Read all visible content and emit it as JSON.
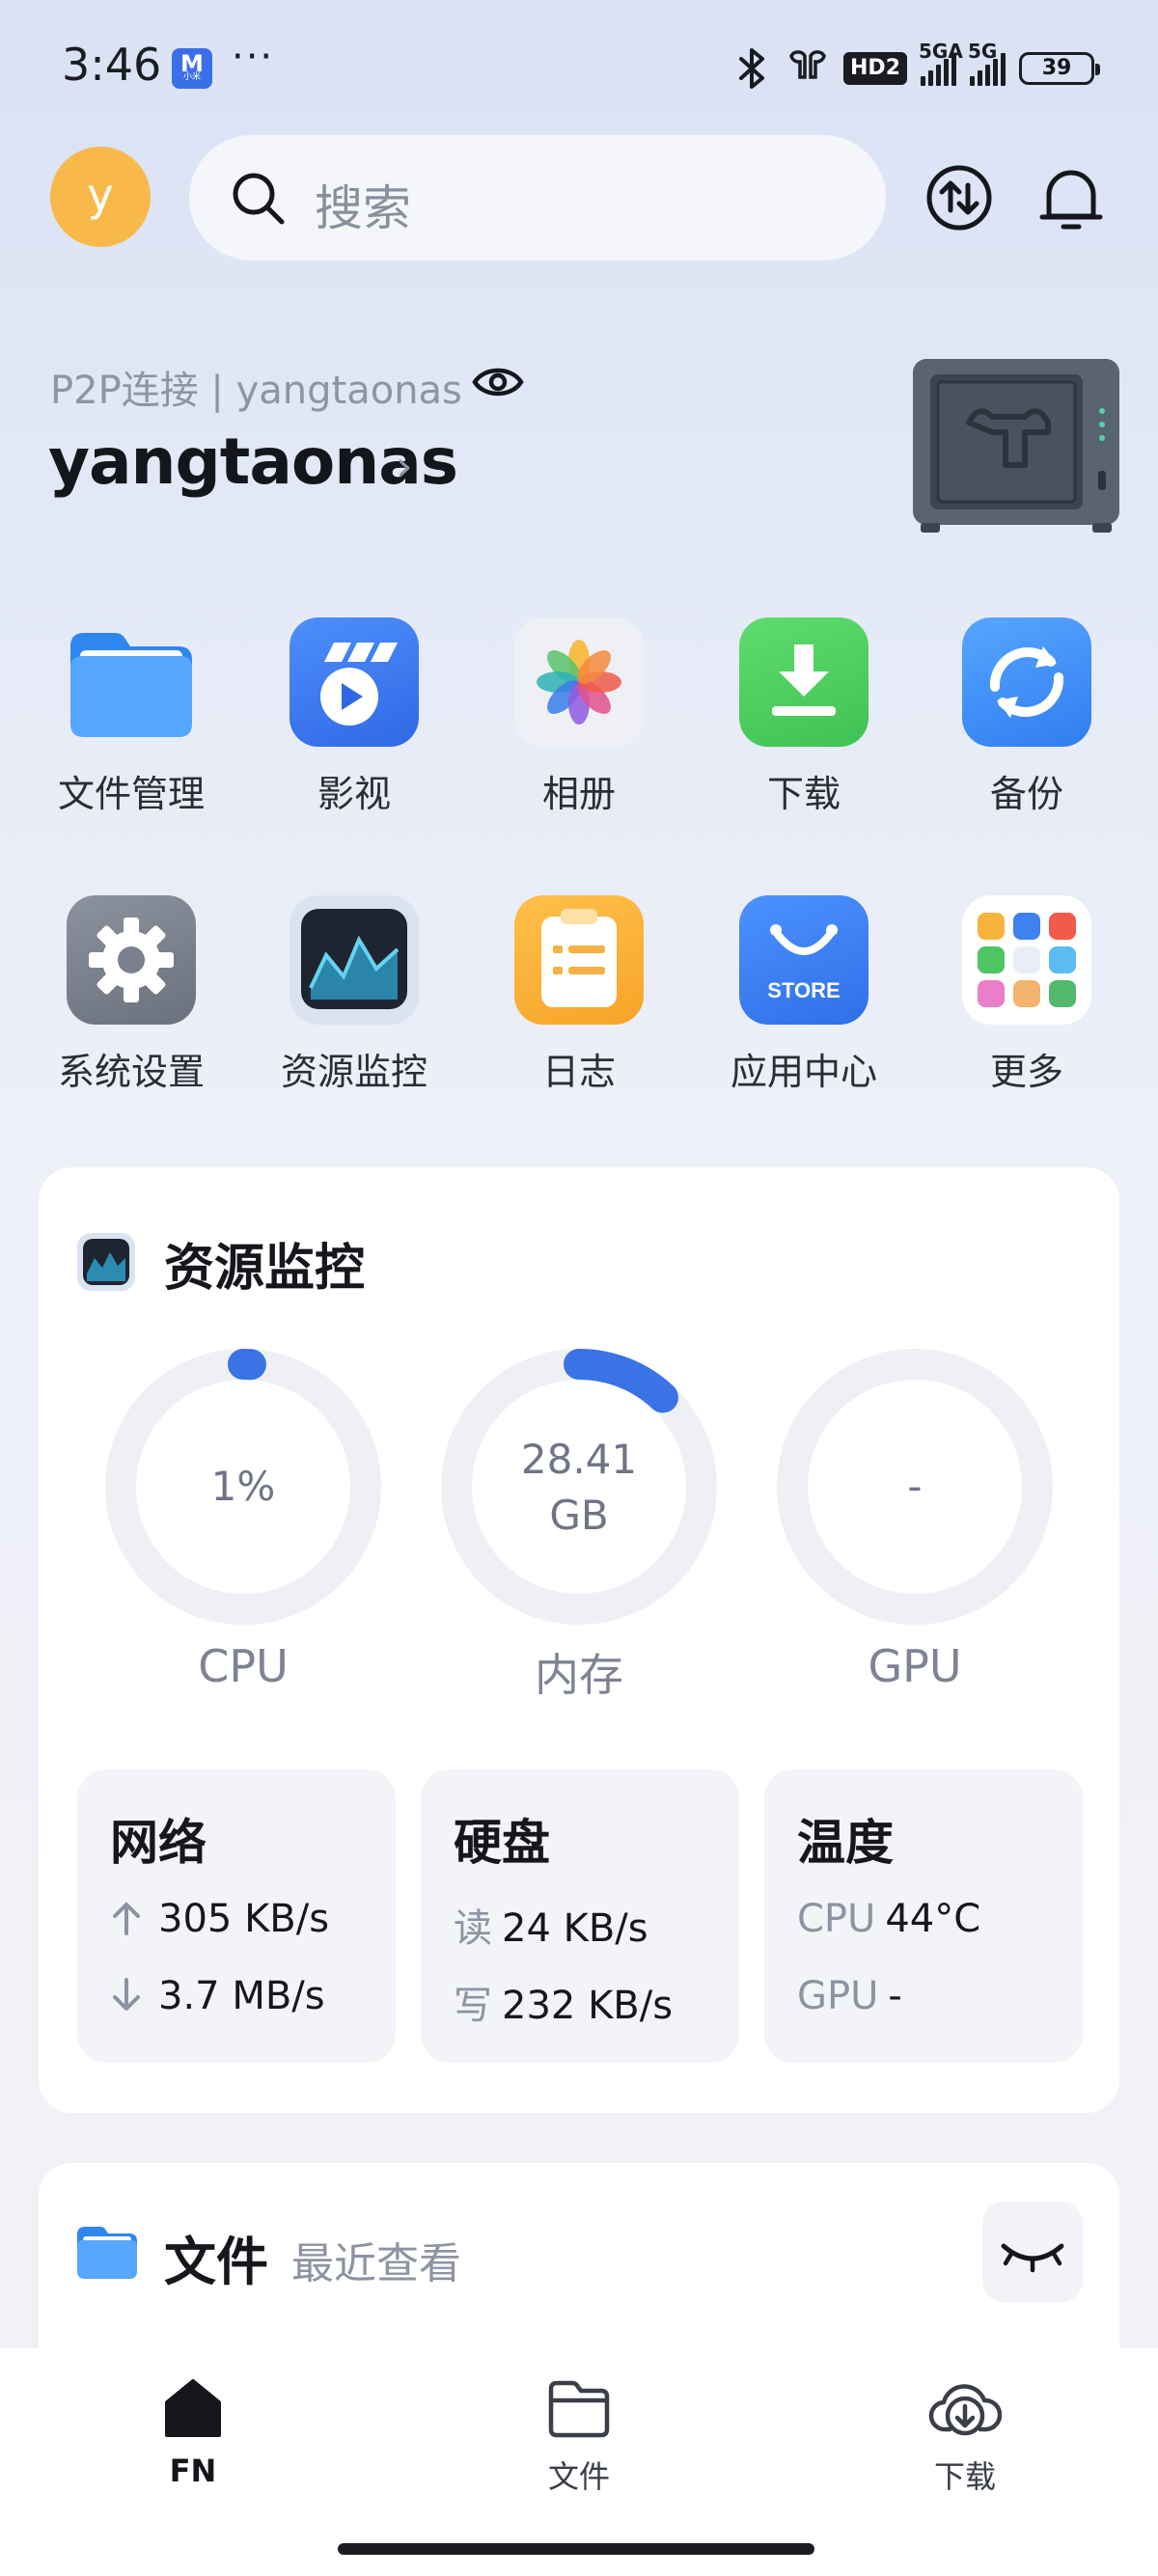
{
  "status_bar": {
    "time": "3:46",
    "app_badge": "M",
    "app_badge_sub": "小米",
    "overflow": "···",
    "net1": "5GA",
    "net2": "5G",
    "hd": "HD2",
    "battery": "39",
    "icons": [
      "bluetooth-icon",
      "earbuds-icon"
    ]
  },
  "header": {
    "avatar_letter": "y",
    "search_placeholder": "搜索",
    "icons": [
      "search-icon",
      "transfer-icon",
      "bell-icon"
    ]
  },
  "device": {
    "connection": "P2P连接 | yangtaonas",
    "name": "yangtaonas"
  },
  "apps": [
    {
      "label": "文件管理",
      "icon": "folder-icon"
    },
    {
      "label": "影视",
      "icon": "video-icon"
    },
    {
      "label": "相册",
      "icon": "photos-icon"
    },
    {
      "label": "下载",
      "icon": "download-icon"
    },
    {
      "label": "备份",
      "icon": "backup-icon"
    },
    {
      "label": "系统设置",
      "icon": "settings-icon"
    },
    {
      "label": "资源监控",
      "icon": "monitor-icon"
    },
    {
      "label": "日志",
      "icon": "log-icon"
    },
    {
      "label": "应用中心",
      "icon": "store-icon",
      "badge": "STORE"
    },
    {
      "label": "更多",
      "icon": "more-apps-icon"
    }
  ],
  "resource_monitor": {
    "title": "资源监控",
    "gauges": [
      {
        "label": "CPU",
        "value": "1%",
        "fraction": 0.01
      },
      {
        "label": "内存",
        "value_line1": "28.41",
        "value_line2": "GB",
        "fraction": 0.12
      },
      {
        "label": "GPU",
        "value": "-",
        "fraction": 0
      }
    ],
    "network": {
      "title": "网络",
      "up": "305 KB/s",
      "down": "3.7 MB/s"
    },
    "disk": {
      "title": "硬盘",
      "read_key": "读",
      "read": "24 KB/s",
      "write_key": "写",
      "write": "232 KB/s"
    },
    "temperature": {
      "title": "温度",
      "cpu_key": "CPU",
      "cpu": "44°C",
      "gpu_key": "GPU",
      "gpu": "-"
    }
  },
  "files": {
    "title": "文件",
    "subtitle": "最近查看"
  },
  "bottom_nav": [
    {
      "label": "FN",
      "icon": "home-icon",
      "active": true
    },
    {
      "label": "文件",
      "icon": "folder-outline-icon",
      "active": false
    },
    {
      "label": "下载",
      "icon": "cloud-download-icon",
      "active": false
    }
  ],
  "colors": {
    "accent": "#3a73e6",
    "avatar": "#f8b94a",
    "ring_track": "#eef0f5"
  }
}
